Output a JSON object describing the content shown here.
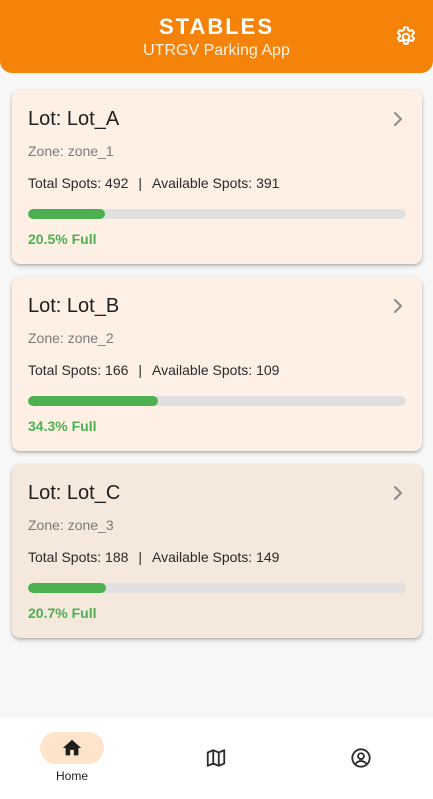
{
  "header": {
    "title": "STABLES",
    "subtitle": "UTRGV Parking App",
    "settings_icon": "gear-icon",
    "background_color": "#f5830a"
  },
  "lots": [
    {
      "name": "Lot: Lot_A",
      "zone": "Zone: zone_1",
      "total_label": "Total Spots: 492",
      "separator": "|",
      "available_label": "Available Spots: 391",
      "fill_percent": 20.5,
      "full_label": "20.5% Full",
      "selected": false
    },
    {
      "name": "Lot: Lot_B",
      "zone": "Zone: zone_2",
      "total_label": "Total Spots: 166",
      "separator": "|",
      "available_label": "Available Spots: 109",
      "fill_percent": 34.3,
      "full_label": "34.3% Full",
      "selected": false
    },
    {
      "name": "Lot: Lot_C",
      "zone": "Zone: zone_3",
      "total_label": "Total Spots: 188",
      "separator": "|",
      "available_label": "Available Spots: 149",
      "fill_percent": 20.7,
      "full_label": "20.7% Full",
      "selected": true
    }
  ],
  "bottom_nav": {
    "items": [
      {
        "label": "Home",
        "icon": "home-icon",
        "active": true
      },
      {
        "label": "",
        "icon": "map-icon",
        "active": false
      },
      {
        "label": "",
        "icon": "account-circle-icon",
        "active": false
      }
    ]
  },
  "colors": {
    "accent": "#f5830a",
    "progress": "#4caf50",
    "card": "#fff0e5"
  }
}
